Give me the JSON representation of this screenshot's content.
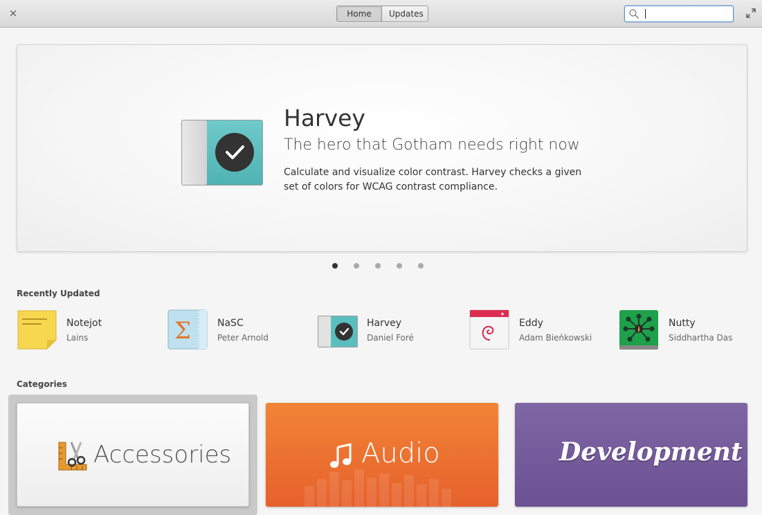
{
  "header": {
    "close_glyph": "×",
    "tabs": [
      {
        "label": "Home",
        "active": true
      },
      {
        "label": "Updates",
        "active": false
      }
    ],
    "search": {
      "value": "",
      "placeholder": ""
    }
  },
  "banner": {
    "app_name": "Harvey",
    "tagline": "The hero that Gotham needs right now",
    "description": "Calculate and visualize color contrast. Harvey checks a given set of colors for WCAG contrast compliance.",
    "icon": "harvey-icon",
    "page_count": 5,
    "active_page": 1
  },
  "recently_updated": {
    "title": "Recently Updated",
    "apps": [
      {
        "name": "Notejot",
        "developer": "Lains",
        "icon": "notejot-icon"
      },
      {
        "name": "NaSC",
        "developer": "Peter Arnold",
        "icon": "nasc-icon"
      },
      {
        "name": "Harvey",
        "developer": "Daniel Foré",
        "icon": "harvey-icon"
      },
      {
        "name": "Eddy",
        "developer": "Adam Bieńkowski",
        "icon": "eddy-icon"
      },
      {
        "name": "Nutty",
        "developer": "Siddhartha Das",
        "icon": "nutty-icon"
      }
    ]
  },
  "categories": {
    "title": "Categories",
    "items": [
      {
        "label": "Accessories",
        "icon": "accessories-icon",
        "color": "#f4f4f4"
      },
      {
        "label": "Audio",
        "icon": "music-note-icon",
        "color": "#ea6e30"
      },
      {
        "label": "Development",
        "icon": "",
        "color": "#765c9d"
      }
    ]
  },
  "colors": {
    "accent": "#5b8fcd",
    "harvey_teal": "#5cbfbf",
    "audio_orange": "#ea6e30",
    "development_purple": "#765c9d"
  }
}
